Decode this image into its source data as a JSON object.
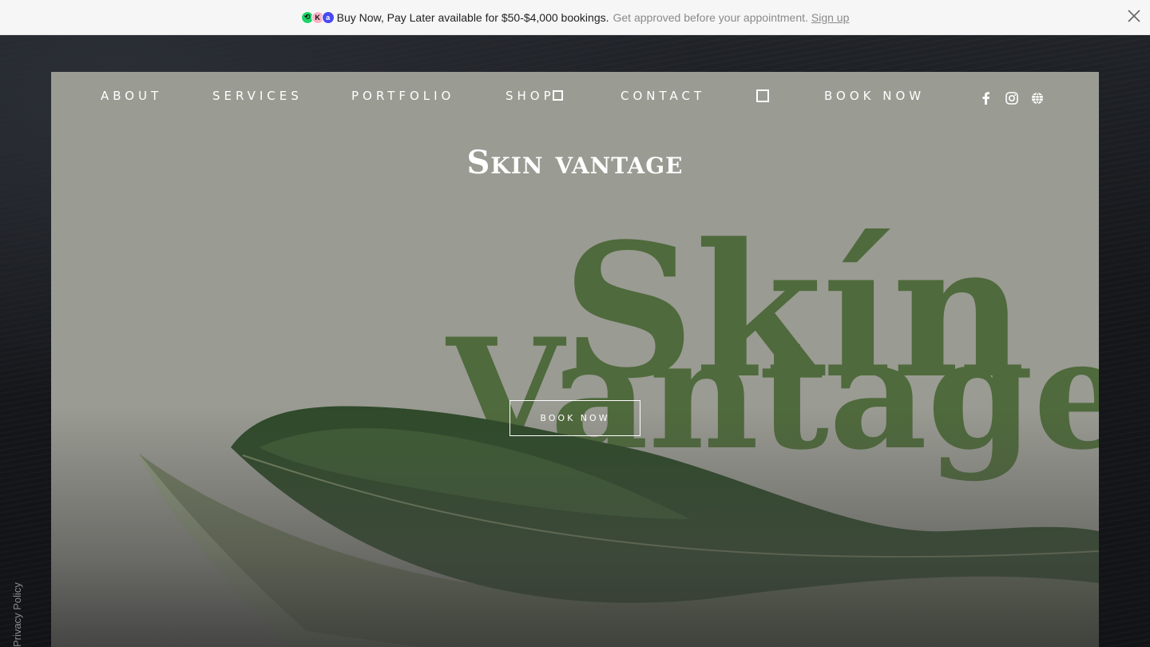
{
  "promo": {
    "logos": [
      "afterpay-logo",
      "klarna-logo",
      "affirm-logo"
    ],
    "logo_glyphs": {
      "afterpay": "⟲",
      "klarna": "K",
      "affirm": "a"
    },
    "main_text": "Buy Now, Pay Later available for $50-$4,000 bookings.",
    "sub_text": "Get approved before your appointment.",
    "link_text": "Sign up",
    "close_icon": "close-icon"
  },
  "nav": {
    "items": [
      "ABOUT",
      "SERVICES",
      "PORTFOLIO",
      "SHOP",
      "CONTACT",
      "BOOK NOW"
    ],
    "socials": [
      "facebook-icon",
      "instagram-icon",
      "globe-icon"
    ]
  },
  "hero": {
    "title": "Skin vantage",
    "title_first_letter": "S",
    "title_rest": "kin vantage",
    "logo_lines": [
      "Skín",
      "Vantage"
    ],
    "cta_label": "BOOK NOW"
  },
  "footer": {
    "privacy_label": "Privacy Policy"
  },
  "colors": {
    "panel": "#9a9b93",
    "logo_green": "#4f6a3c",
    "leaf_dark": "#2f4a2a",
    "promo_bg": "#f6f6f6"
  }
}
